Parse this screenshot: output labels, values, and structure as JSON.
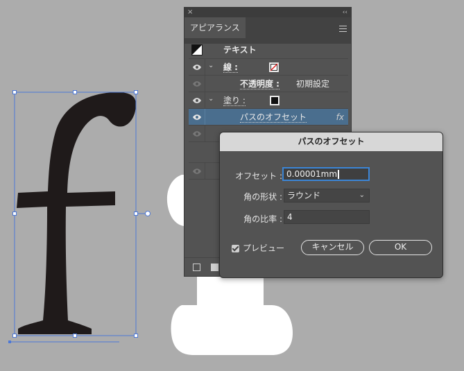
{
  "panel": {
    "title": "アピアランス",
    "close_glyph": "×",
    "collapse_glyph": "‹‹",
    "rows": {
      "text_label": "テキスト",
      "stroke_label": "線 :",
      "opacity_label": "不透明度 :",
      "opacity_value": "初期設定",
      "fill_label": "塗り :",
      "effect_label": "パスのオフセット",
      "fx_label": "fx"
    }
  },
  "dialog": {
    "title": "パスのオフセット",
    "offset_label": "オフセット :",
    "offset_value": "0.00001mm",
    "corner_label": "角の形状 :",
    "corner_value": "ラウンド",
    "miter_label": "角の比率 :",
    "miter_value": "4",
    "preview_label": "プレビュー",
    "preview_checked": true,
    "cancel_label": "キャンセル",
    "ok_label": "OK"
  },
  "colors": {
    "canvas": "#acacac",
    "panel_bg": "#535353",
    "selection": "#4a6e8e",
    "bounding_box": "#4d78d6",
    "glyph": "#1f1a1a"
  }
}
